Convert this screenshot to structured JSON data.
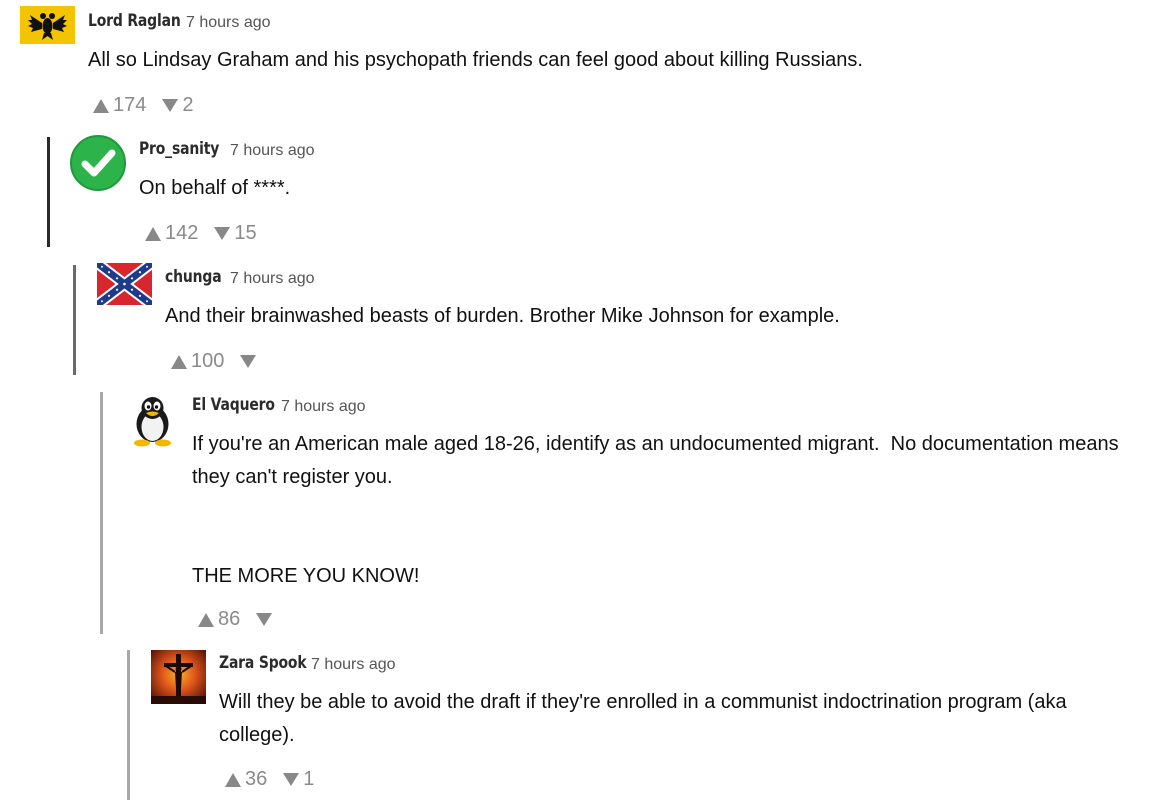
{
  "colors": {
    "thread_line_dark": "#2a2a2a",
    "thread_line_mid": "#6a6a6a",
    "thread_line_light": "#a8a8a8",
    "vote_gray": "#888888",
    "username": "#2b2b2b"
  },
  "comments": [
    {
      "username": "Lord Raglan",
      "time": "7 hours ago",
      "avatar_icon": "black-eagle-on-yellow-icon",
      "text": "All so Lindsay Graham and his psychopath friends can feel good about killing Russians.",
      "upvotes": "174",
      "downvotes": "2"
    },
    {
      "username": "Pro_sanity",
      "time": "7 hours ago",
      "avatar_icon": "green-checkmark-icon",
      "text": "On behalf of ****.",
      "upvotes": "142",
      "downvotes": "15"
    },
    {
      "username": "chunga",
      "time": "7 hours ago",
      "avatar_icon": "confederate-flag-icon",
      "text": "And their brainwashed beasts of burden. Brother Mike Johnson for example.",
      "upvotes": "100",
      "downvotes": ""
    },
    {
      "username": "El Vaquero",
      "time": "7 hours ago",
      "avatar_icon": "penguin-icon",
      "text": "If you're an American male aged 18-26, identify as an undocumented migrant.  No documentation means they can't register you.\n\n\nTHE MORE YOU KNOW!",
      "upvotes": "86",
      "downvotes": ""
    },
    {
      "username": "Zara Spook",
      "time": "7 hours ago",
      "avatar_icon": "crucifix-sunset-icon",
      "text": "Will they be able to avoid the draft if they're enrolled in a communist indoctrination program (aka college).",
      "upvotes": "36",
      "downvotes": "1"
    }
  ]
}
